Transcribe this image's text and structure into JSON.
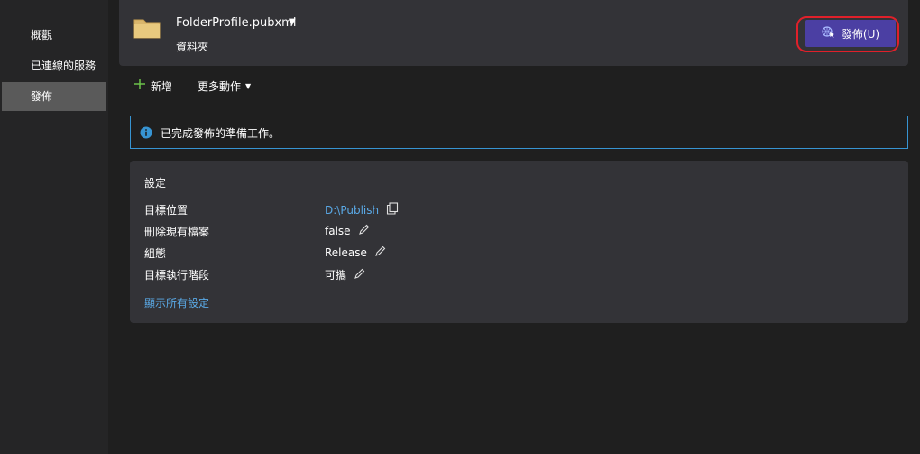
{
  "sidebar": {
    "items": [
      {
        "label": "概觀",
        "active": false
      },
      {
        "label": "已連線的服務",
        "active": false
      },
      {
        "label": "發佈",
        "active": true
      }
    ]
  },
  "header": {
    "profile_title": "FolderProfile.pubxml",
    "profile_subtitle": "資料夾",
    "publish_label": "發佈(U)",
    "icons": {
      "folder": "folder-icon",
      "dropdown": "caret-down-icon",
      "publish": "globe-cursor-icon"
    }
  },
  "toolbar": {
    "new_label": "新增",
    "more_actions_label": "更多動作"
  },
  "info_bar": {
    "message": "已完成發佈的準備工作。"
  },
  "settings": {
    "title": "設定",
    "rows": [
      {
        "label": "目標位置",
        "value": "D:\\Publish",
        "action": "copy"
      },
      {
        "label": "刪除現有檔案",
        "value": "false",
        "action": "edit"
      },
      {
        "label": "組態",
        "value": "Release",
        "action": "edit"
      },
      {
        "label": "目標執行階段",
        "value": "可攜",
        "action": "edit"
      }
    ],
    "show_all_label": "顯示所有設定"
  },
  "colors": {
    "accent_button": "#4b3fa3",
    "highlight_ring": "#e0202a",
    "info_border": "#3794d2",
    "link": "#5aa9e6",
    "plus_green": "#6cc24a"
  }
}
